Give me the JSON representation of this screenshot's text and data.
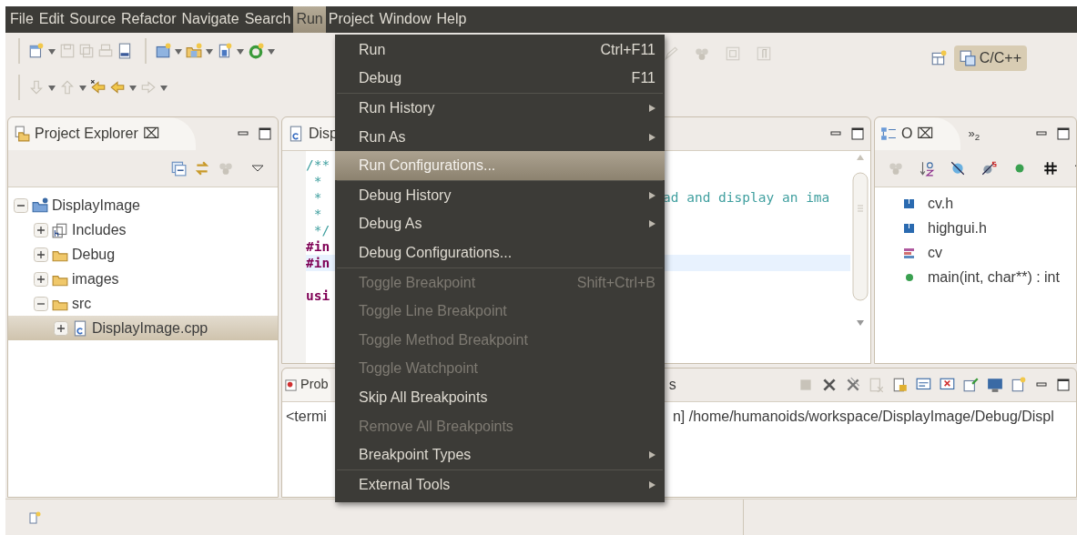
{
  "menubar": [
    {
      "label": "File",
      "selected": false
    },
    {
      "label": "Edit",
      "selected": false
    },
    {
      "label": "Source",
      "selected": false
    },
    {
      "label": "Refactor",
      "selected": false
    },
    {
      "label": "Navigate",
      "selected": false
    },
    {
      "label": "Search",
      "selected": false
    },
    {
      "label": "Run",
      "selected": true
    },
    {
      "label": "Project",
      "selected": false
    },
    {
      "label": "Window",
      "selected": false
    },
    {
      "label": "Help",
      "selected": false
    }
  ],
  "perspective": {
    "label": "C/C++",
    "selected": true
  },
  "project_explorer": {
    "title": "Project Explorer",
    "close": "⌧",
    "tree": [
      {
        "label": "DisplayImage",
        "kind": "project",
        "expanded": true,
        "selected": false,
        "children": [
          {
            "label": "Includes",
            "kind": "includes",
            "expanded": false,
            "selected": false
          },
          {
            "label": "Debug",
            "kind": "folder",
            "expanded": false,
            "selected": false
          },
          {
            "label": "images",
            "kind": "folder",
            "expanded": false,
            "selected": false
          },
          {
            "label": "src",
            "kind": "folder",
            "expanded": true,
            "selected": false,
            "children": [
              {
                "label": "DisplayImage.cpp",
                "kind": "cfile",
                "expanded": false,
                "selected": true
              }
            ]
          }
        ]
      }
    ]
  },
  "editor": {
    "tab": "Disp",
    "lines": [
      {
        "left": "/**",
        "kind": "comment",
        "highlighted": false
      },
      {
        "left": " *",
        "kind": "comment",
        "highlighted": false
      },
      {
        "left": " *",
        "right": "ad and display an ima",
        "kind": "comment",
        "highlighted": false
      },
      {
        "left": " *",
        "kind": "comment",
        "highlighted": false
      },
      {
        "left": " */",
        "kind": "comment",
        "highlighted": false
      },
      {
        "left": "#in",
        "kind": "keyword",
        "highlighted": false
      },
      {
        "left": "#in",
        "kind": "keyword",
        "highlighted": true
      },
      {
        "kind": "plain",
        "highlighted": false
      },
      {
        "left": "usi",
        "kind": "keyword",
        "highlighted": false
      }
    ]
  },
  "outline": {
    "title": "O",
    "close": "⌧",
    "overflow": "»$_{2}$",
    "items": [
      {
        "label": "cv.h",
        "kind": "include"
      },
      {
        "label": "highgui.h",
        "kind": "include"
      },
      {
        "label": "cv",
        "kind": "namespace"
      },
      {
        "label": "main(int, char**) : int",
        "kind": "function"
      }
    ]
  },
  "console": {
    "tab_left": "Prob",
    "tab_right": "s",
    "line_left": "<termi",
    "line_right": "n] /home/humanoids/workspace/DisplayImage/Debug/Displ"
  },
  "run_menu": [
    {
      "kind": "item",
      "label": "Run",
      "shortcut": "Ctrl+F11",
      "submenu": false,
      "disabled": false,
      "selected": false
    },
    {
      "kind": "item",
      "label": "Debug",
      "shortcut": "F11",
      "submenu": false,
      "disabled": false,
      "selected": false
    },
    {
      "kind": "separator"
    },
    {
      "kind": "item",
      "label": "Run History",
      "submenu": true,
      "disabled": false,
      "selected": false
    },
    {
      "kind": "item",
      "label": "Run As",
      "submenu": true,
      "disabled": false,
      "selected": false
    },
    {
      "kind": "item",
      "label": "Run Configurations...",
      "submenu": false,
      "disabled": false,
      "selected": true
    },
    {
      "kind": "separator"
    },
    {
      "kind": "item",
      "label": "Debug History",
      "submenu": true,
      "disabled": false,
      "selected": false
    },
    {
      "kind": "item",
      "label": "Debug As",
      "submenu": true,
      "disabled": false,
      "selected": false
    },
    {
      "kind": "item",
      "label": "Debug Configurations...",
      "submenu": false,
      "disabled": false,
      "selected": false
    },
    {
      "kind": "separator"
    },
    {
      "kind": "item",
      "label": "Toggle Breakpoint",
      "shortcut": "Shift+Ctrl+B",
      "submenu": false,
      "disabled": true,
      "selected": false
    },
    {
      "kind": "item",
      "label": "Toggle Line Breakpoint",
      "submenu": false,
      "disabled": true,
      "selected": false
    },
    {
      "kind": "item",
      "label": "Toggle Method Breakpoint",
      "submenu": false,
      "disabled": true,
      "selected": false
    },
    {
      "kind": "item",
      "label": "Toggle Watchpoint",
      "submenu": false,
      "disabled": true,
      "selected": false
    },
    {
      "kind": "item",
      "label": "Skip All Breakpoints",
      "submenu": false,
      "disabled": false,
      "selected": false
    },
    {
      "kind": "item",
      "label": "Remove All Breakpoints",
      "submenu": false,
      "disabled": true,
      "selected": false
    },
    {
      "kind": "item",
      "label": "Breakpoint Types",
      "submenu": true,
      "disabled": false,
      "selected": false
    },
    {
      "kind": "separator"
    },
    {
      "kind": "item",
      "label": "External Tools",
      "submenu": true,
      "disabled": false,
      "selected": false
    }
  ]
}
